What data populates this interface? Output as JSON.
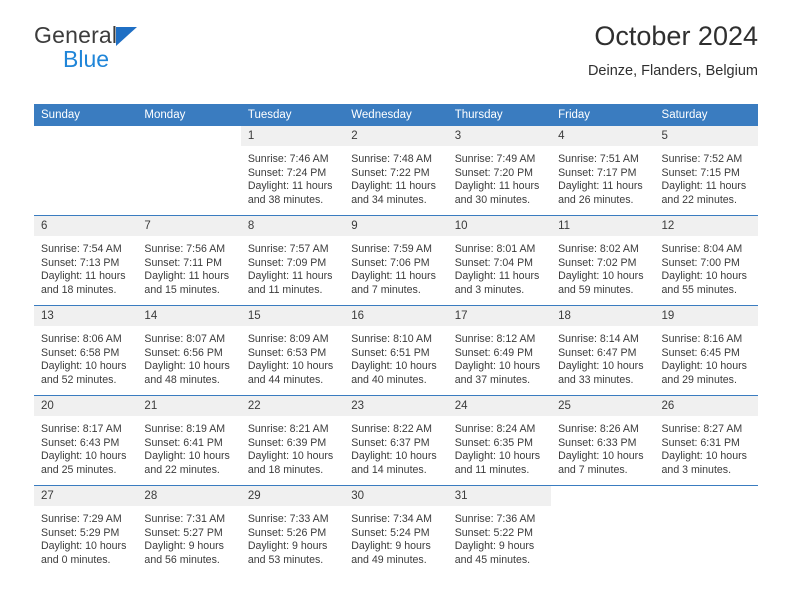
{
  "brand": {
    "line1": "General",
    "line2": "Blue",
    "triangle_color": "#1f6fc4",
    "blue_text_color": "#1f85d8"
  },
  "header": {
    "title": "October 2024",
    "subtitle": "Deinze, Flanders, Belgium"
  },
  "theme": {
    "header_blue": "#3a7cc0",
    "daynum_band": "#f0f0f0",
    "text": "#3b3b3b"
  },
  "weekdays": [
    "Sunday",
    "Monday",
    "Tuesday",
    "Wednesday",
    "Thursday",
    "Friday",
    "Saturday"
  ],
  "labels": {
    "sunrise_prefix": "Sunrise: ",
    "sunset_prefix": "Sunset: ",
    "daylight_prefix": "Daylight: "
  },
  "weeks": [
    [
      {
        "day": "",
        "blank": true
      },
      {
        "day": "",
        "blank": true
      },
      {
        "day": "1",
        "sunrise": "Sunrise: 7:46 AM",
        "sunset": "Sunset: 7:24 PM",
        "daylight": "Daylight: 11 hours and 38 minutes."
      },
      {
        "day": "2",
        "sunrise": "Sunrise: 7:48 AM",
        "sunset": "Sunset: 7:22 PM",
        "daylight": "Daylight: 11 hours and 34 minutes."
      },
      {
        "day": "3",
        "sunrise": "Sunrise: 7:49 AM",
        "sunset": "Sunset: 7:20 PM",
        "daylight": "Daylight: 11 hours and 30 minutes."
      },
      {
        "day": "4",
        "sunrise": "Sunrise: 7:51 AM",
        "sunset": "Sunset: 7:17 PM",
        "daylight": "Daylight: 11 hours and 26 minutes."
      },
      {
        "day": "5",
        "sunrise": "Sunrise: 7:52 AM",
        "sunset": "Sunset: 7:15 PM",
        "daylight": "Daylight: 11 hours and 22 minutes."
      }
    ],
    [
      {
        "day": "6",
        "sunrise": "Sunrise: 7:54 AM",
        "sunset": "Sunset: 7:13 PM",
        "daylight": "Daylight: 11 hours and 18 minutes."
      },
      {
        "day": "7",
        "sunrise": "Sunrise: 7:56 AM",
        "sunset": "Sunset: 7:11 PM",
        "daylight": "Daylight: 11 hours and 15 minutes."
      },
      {
        "day": "8",
        "sunrise": "Sunrise: 7:57 AM",
        "sunset": "Sunset: 7:09 PM",
        "daylight": "Daylight: 11 hours and 11 minutes."
      },
      {
        "day": "9",
        "sunrise": "Sunrise: 7:59 AM",
        "sunset": "Sunset: 7:06 PM",
        "daylight": "Daylight: 11 hours and 7 minutes."
      },
      {
        "day": "10",
        "sunrise": "Sunrise: 8:01 AM",
        "sunset": "Sunset: 7:04 PM",
        "daylight": "Daylight: 11 hours and 3 minutes."
      },
      {
        "day": "11",
        "sunrise": "Sunrise: 8:02 AM",
        "sunset": "Sunset: 7:02 PM",
        "daylight": "Daylight: 10 hours and 59 minutes."
      },
      {
        "day": "12",
        "sunrise": "Sunrise: 8:04 AM",
        "sunset": "Sunset: 7:00 PM",
        "daylight": "Daylight: 10 hours and 55 minutes."
      }
    ],
    [
      {
        "day": "13",
        "sunrise": "Sunrise: 8:06 AM",
        "sunset": "Sunset: 6:58 PM",
        "daylight": "Daylight: 10 hours and 52 minutes."
      },
      {
        "day": "14",
        "sunrise": "Sunrise: 8:07 AM",
        "sunset": "Sunset: 6:56 PM",
        "daylight": "Daylight: 10 hours and 48 minutes."
      },
      {
        "day": "15",
        "sunrise": "Sunrise: 8:09 AM",
        "sunset": "Sunset: 6:53 PM",
        "daylight": "Daylight: 10 hours and 44 minutes."
      },
      {
        "day": "16",
        "sunrise": "Sunrise: 8:10 AM",
        "sunset": "Sunset: 6:51 PM",
        "daylight": "Daylight: 10 hours and 40 minutes."
      },
      {
        "day": "17",
        "sunrise": "Sunrise: 8:12 AM",
        "sunset": "Sunset: 6:49 PM",
        "daylight": "Daylight: 10 hours and 37 minutes."
      },
      {
        "day": "18",
        "sunrise": "Sunrise: 8:14 AM",
        "sunset": "Sunset: 6:47 PM",
        "daylight": "Daylight: 10 hours and 33 minutes."
      },
      {
        "day": "19",
        "sunrise": "Sunrise: 8:16 AM",
        "sunset": "Sunset: 6:45 PM",
        "daylight": "Daylight: 10 hours and 29 minutes."
      }
    ],
    [
      {
        "day": "20",
        "sunrise": "Sunrise: 8:17 AM",
        "sunset": "Sunset: 6:43 PM",
        "daylight": "Daylight: 10 hours and 25 minutes."
      },
      {
        "day": "21",
        "sunrise": "Sunrise: 8:19 AM",
        "sunset": "Sunset: 6:41 PM",
        "daylight": "Daylight: 10 hours and 22 minutes."
      },
      {
        "day": "22",
        "sunrise": "Sunrise: 8:21 AM",
        "sunset": "Sunset: 6:39 PM",
        "daylight": "Daylight: 10 hours and 18 minutes."
      },
      {
        "day": "23",
        "sunrise": "Sunrise: 8:22 AM",
        "sunset": "Sunset: 6:37 PM",
        "daylight": "Daylight: 10 hours and 14 minutes."
      },
      {
        "day": "24",
        "sunrise": "Sunrise: 8:24 AM",
        "sunset": "Sunset: 6:35 PM",
        "daylight": "Daylight: 10 hours and 11 minutes."
      },
      {
        "day": "25",
        "sunrise": "Sunrise: 8:26 AM",
        "sunset": "Sunset: 6:33 PM",
        "daylight": "Daylight: 10 hours and 7 minutes."
      },
      {
        "day": "26",
        "sunrise": "Sunrise: 8:27 AM",
        "sunset": "Sunset: 6:31 PM",
        "daylight": "Daylight: 10 hours and 3 minutes."
      }
    ],
    [
      {
        "day": "27",
        "sunrise": "Sunrise: 7:29 AM",
        "sunset": "Sunset: 5:29 PM",
        "daylight": "Daylight: 10 hours and 0 minutes."
      },
      {
        "day": "28",
        "sunrise": "Sunrise: 7:31 AM",
        "sunset": "Sunset: 5:27 PM",
        "daylight": "Daylight: 9 hours and 56 minutes."
      },
      {
        "day": "29",
        "sunrise": "Sunrise: 7:33 AM",
        "sunset": "Sunset: 5:26 PM",
        "daylight": "Daylight: 9 hours and 53 minutes."
      },
      {
        "day": "30",
        "sunrise": "Sunrise: 7:34 AM",
        "sunset": "Sunset: 5:24 PM",
        "daylight": "Daylight: 9 hours and 49 minutes."
      },
      {
        "day": "31",
        "sunrise": "Sunrise: 7:36 AM",
        "sunset": "Sunset: 5:22 PM",
        "daylight": "Daylight: 9 hours and 45 minutes."
      },
      {
        "day": "",
        "blank": true
      },
      {
        "day": "",
        "blank": true
      }
    ]
  ]
}
